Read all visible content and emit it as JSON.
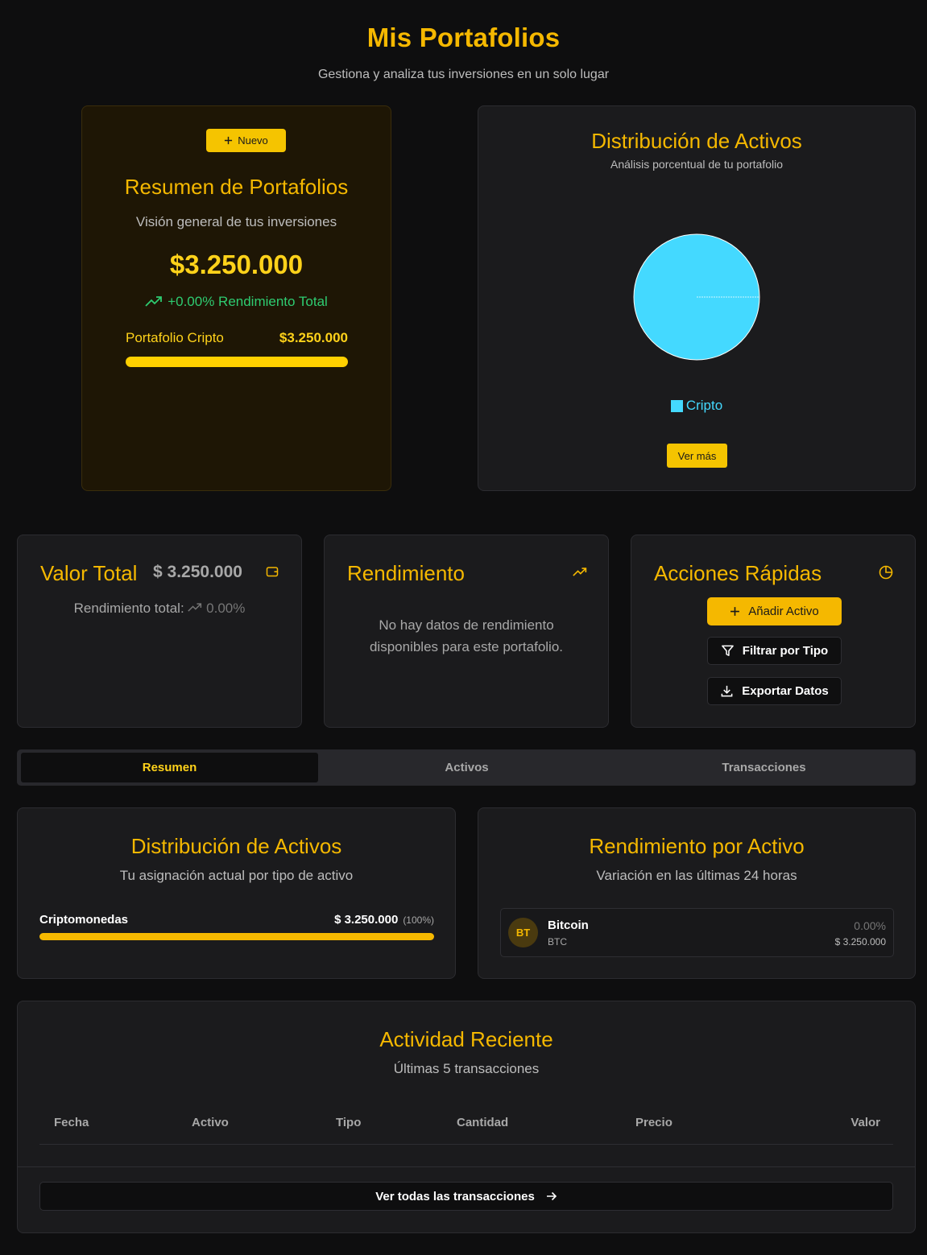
{
  "header": {
    "title": "Mis Portafolios",
    "subtitle": "Gestiona y analiza tus inversiones en un solo lugar"
  },
  "summary": {
    "new_button": "Nuevo",
    "title": "Resumen de Portafolios",
    "subtitle": "Visión general de tus inversiones",
    "total": "$3.250.000",
    "performance": "+0.00% Rendimiento Total",
    "portfolio_name": "Portafolio Cripto",
    "portfolio_value": "$3.250.000",
    "portfolio_share": 1.0
  },
  "distribution_chart": {
    "title": "Distribución de Activos",
    "subtitle": "Análisis porcentual de tu portafolio",
    "more_button": "Ver más"
  },
  "chart_data": {
    "type": "pie",
    "series": [
      {
        "name": "Cripto",
        "value": 100,
        "color": "#44d9ff"
      }
    ],
    "legend": "bottom"
  },
  "stats": {
    "total": {
      "title": "Valor Total",
      "value": "$ 3.250.000",
      "label": "Rendimiento total:",
      "pct": "0.00%"
    },
    "performance": {
      "title": "Rendimiento",
      "message_line1": "No hay datos de rendimiento",
      "message_line2": "disponibles para este portafolio."
    },
    "quick": {
      "title": "Acciones Rápidas",
      "add": "Añadir Activo",
      "filter": "Filtrar por Tipo",
      "export": "Exportar Datos"
    }
  },
  "tabs": [
    "Resumen",
    "Activos",
    "Transacciones"
  ],
  "allocation": {
    "title": "Distribución de Activos",
    "subtitle": "Tu asignación actual por tipo de activo",
    "items": [
      {
        "name": "Criptomonedas",
        "value": "$ 3.250.000",
        "pct": "(100%)",
        "share": 1.0
      }
    ]
  },
  "asset_performance": {
    "title": "Rendimiento por Activo",
    "subtitle": "Variación en las últimas 24 horas",
    "items": [
      {
        "avatar": "BT",
        "name": "Bitcoin",
        "symbol": "BTC",
        "change": "0.00%",
        "value": "$ 3.250.000"
      }
    ]
  },
  "activity": {
    "title": "Actividad Reciente",
    "subtitle": "Últimas 5 transacciones",
    "columns": [
      "Fecha",
      "Activo",
      "Tipo",
      "Cantidad",
      "Precio",
      "Valor"
    ],
    "view_all": "Ver todas las transacciones"
  },
  "colors": {
    "accent": "#f5b800",
    "positive": "#2ecc71",
    "crypto": "#44d9ff"
  }
}
